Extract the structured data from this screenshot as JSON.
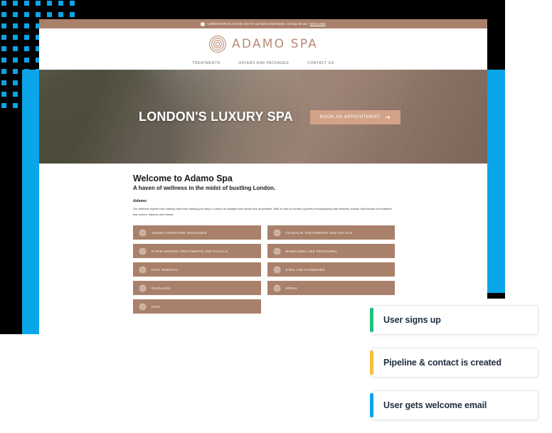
{
  "decor": {
    "dot_color": "#0ba5e9",
    "bar_color": "#0ba5e9",
    "backdrop_color": "#000000",
    "dot_columns": 7,
    "dot_rows": 10
  },
  "website": {
    "covid_banner": {
      "icon": "info-icon",
      "text": "CORONAVIRUS (COVID-19) For our latest information, on how we are",
      "link_text": "here to help",
      "background": "#a9806a"
    },
    "header": {
      "logo_icon": "adamo-spa-logo-mark",
      "logo_text": "ADAMO SPA",
      "logo_color": "#b98a72",
      "nav": [
        {
          "label": "TREATMENTS"
        },
        {
          "label": "OFFERS AND PACKAGES"
        },
        {
          "label": "CONTACT US"
        }
      ]
    },
    "hero": {
      "title": "LONDON'S LUXURY SPA",
      "cta_label": "BOOK AN APPOINTMENT",
      "cta_icon": "arrow-right-icon",
      "cta_color": "#d2a387"
    },
    "welcome": {
      "title": "Welcome to Adamo Spa",
      "subtitle": "A haven of wellness in the midst of bustling London.",
      "kicker": "Adamo",
      "body": "Our wellness experts love nothing more than making your stay in London as indulgent and stress-free as possible. With an aim to provide a journey encompassing total wellness, Adamo Spa focuses on treatment that nurture, balance and restore."
    },
    "treatments": {
      "button_color": "#a9806a",
      "items": [
        {
          "label": "ADAMO SIGNATURE MASSAGES"
        },
        {
          "label": "CAUDALIE TREATMENTS AND FACIALS"
        },
        {
          "label": "KARIN HERZOG TREATMENTS AND FACIALS"
        },
        {
          "label": "MANICURES AND PEDICURES"
        },
        {
          "label": "HAIR REMOVAL"
        },
        {
          "label": "EYES AND EYEBROWS"
        },
        {
          "label": "PACKAGES"
        },
        {
          "label": "BREAK"
        },
        {
          "label": "HAIR"
        }
      ]
    }
  },
  "workflow_cards": [
    {
      "label": "User signs up",
      "accent": "#1fc27d"
    },
    {
      "label": "Pipeline & contact is created",
      "accent": "#f5bf3f"
    },
    {
      "label": "User gets welcome email",
      "accent": "#0ba5e9"
    }
  ]
}
